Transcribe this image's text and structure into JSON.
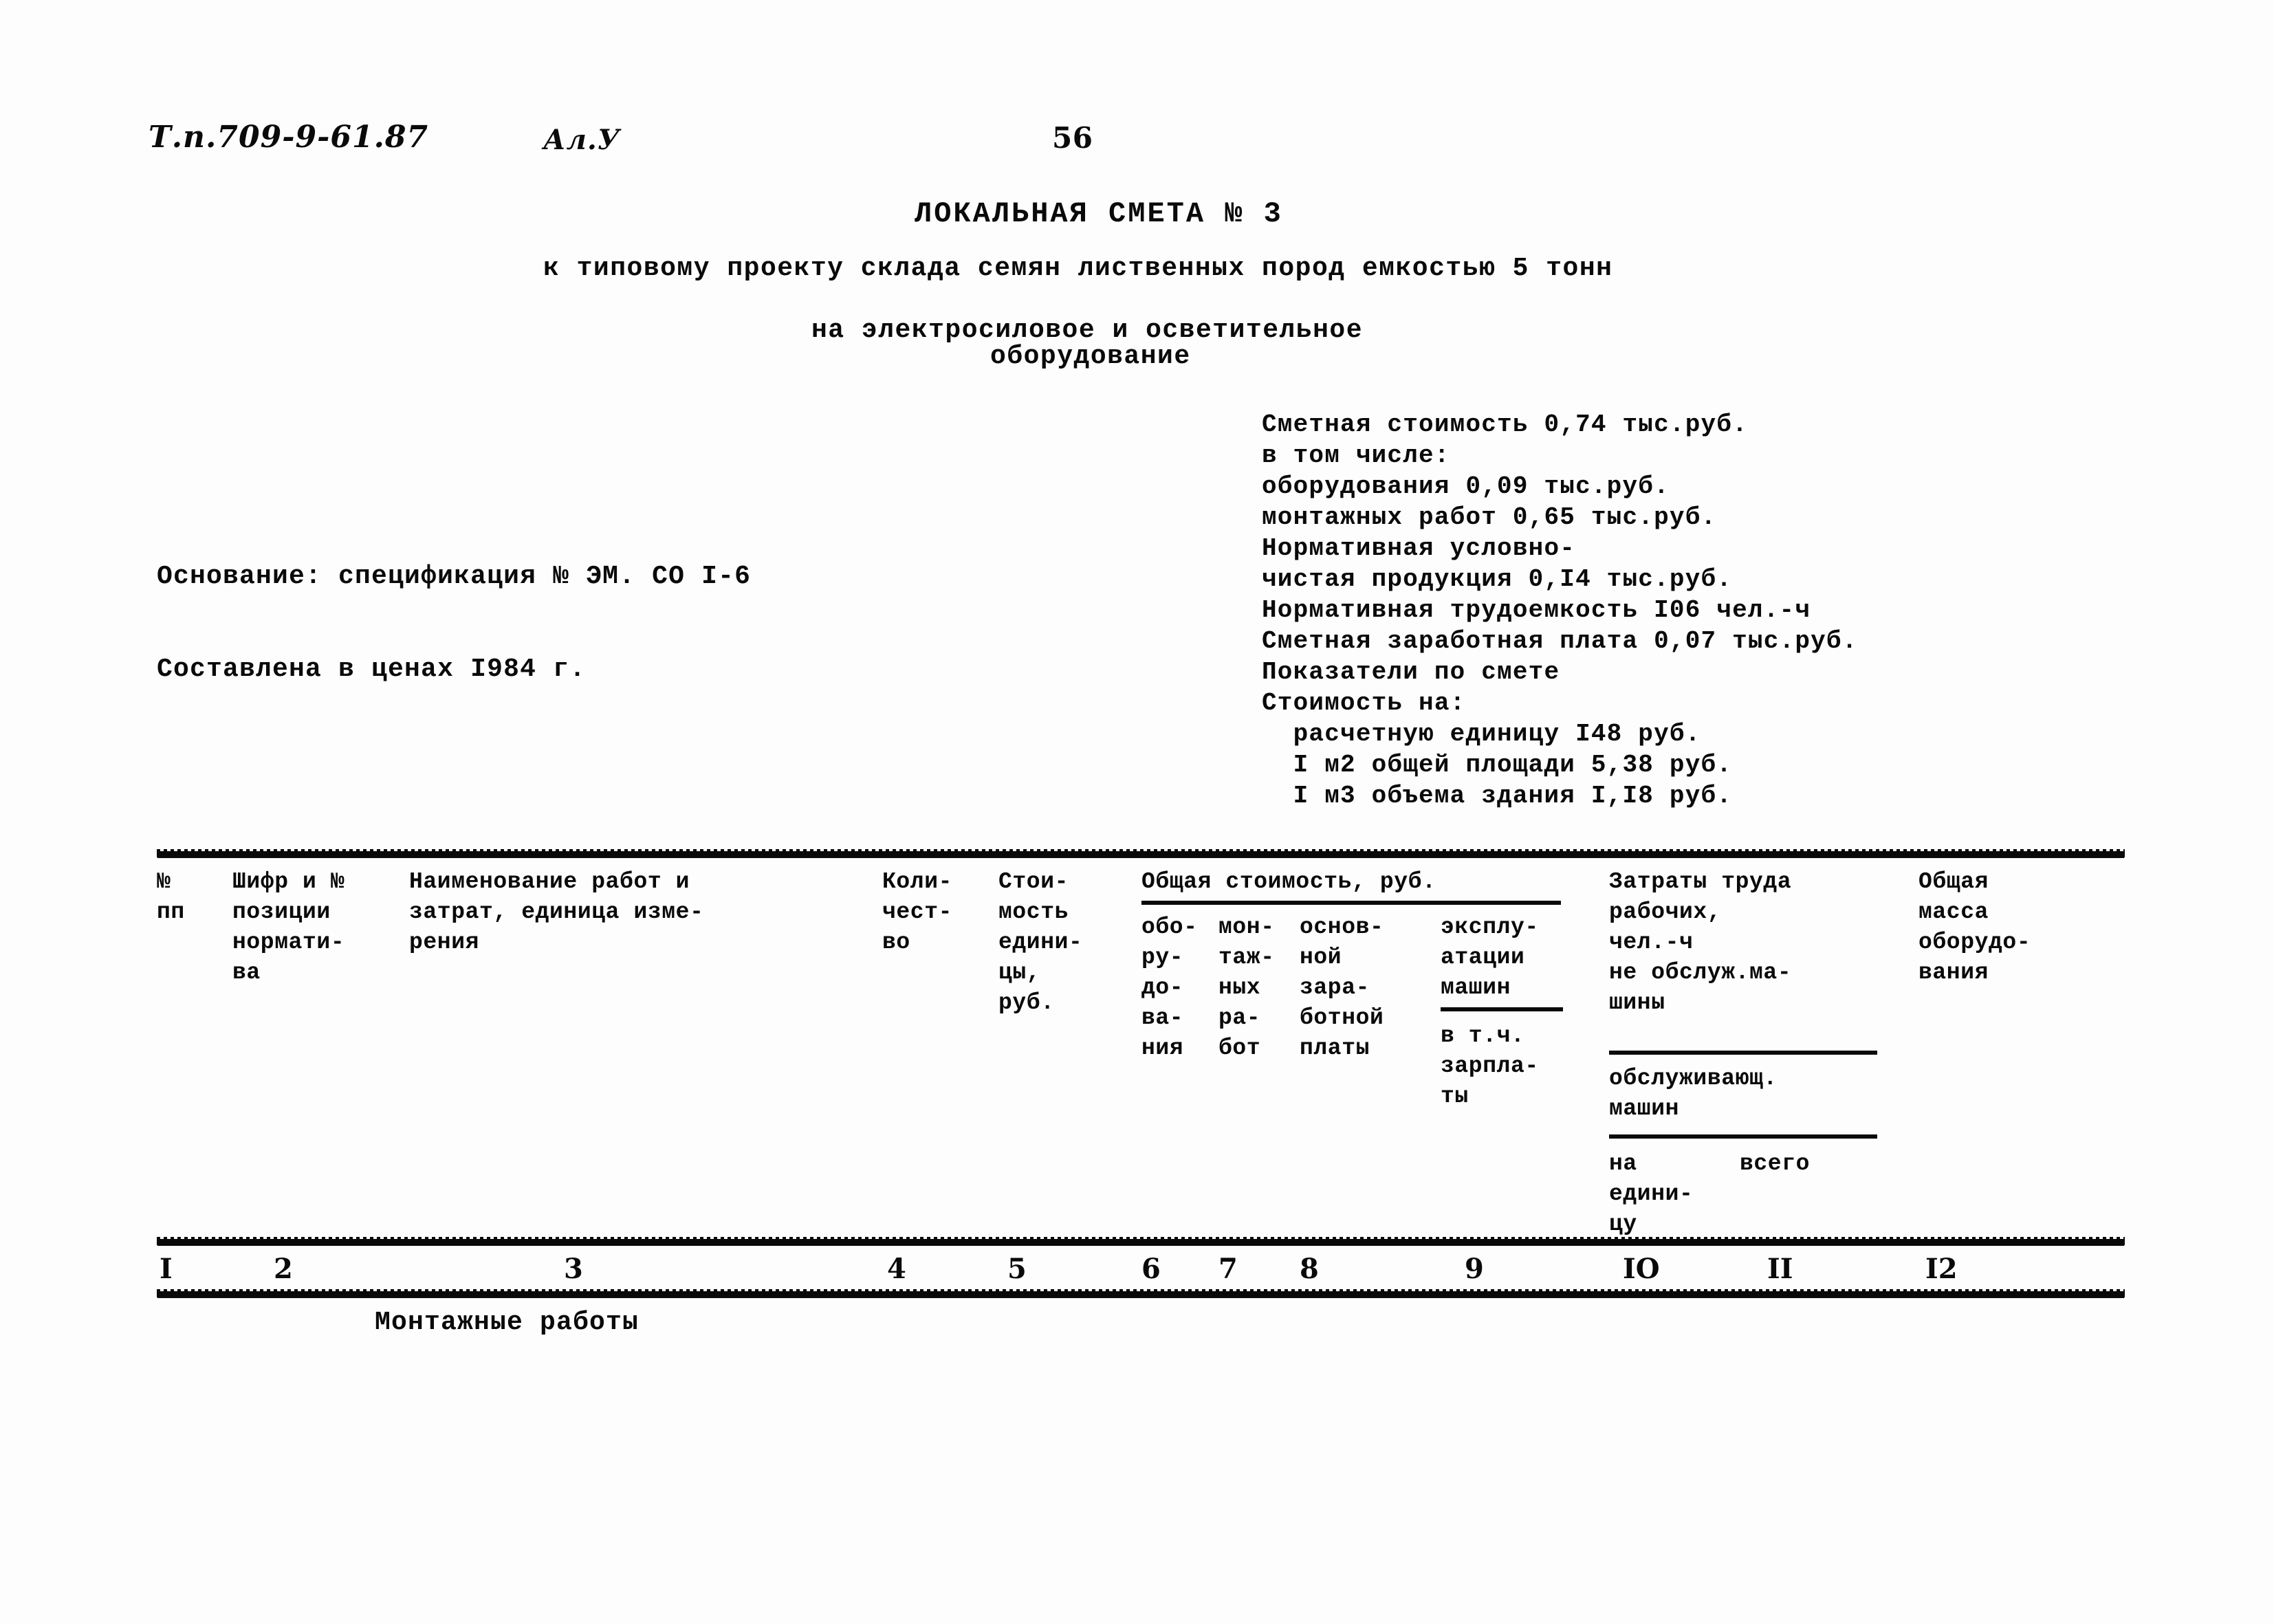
{
  "document": {
    "project_code": "Т.п.709-9-61.87",
    "album": "Ал.У",
    "page_number": "56",
    "title": "ЛОКАЛЬНАЯ СМЕТА № 3",
    "subtitle_line1": "к типовому проекту склада семян лиственных пород емкостью 5 тонн",
    "subtitle_line2": "на электросиловое и осветительное",
    "subtitle_line3": "оборудование",
    "basis": "Основание: спецификация № ЭМ. СО I-6",
    "prices": "Составлена в ценах I984 г."
  },
  "summary": {
    "lines": [
      "Сметная стоимость 0,74 тыс.руб.",
      "в том числе:",
      "оборудования 0,09 тыс.руб.",
      "монтажных работ 0,65 тыс.руб.",
      "Нормативная условно-",
      "чистая продукция 0,I4 тыс.руб.",
      "Нормативная трудоемкость I06 чел.-ч",
      "Сметная заработная плата 0,07 тыс.руб.",
      "Показатели по смете",
      "Стоимость на:",
      "  расчетную единицу I48 руб.",
      "  I м2 общей площади 5,38 руб.",
      "  I м3 объема здания I,I8 руб."
    ]
  },
  "table": {
    "headers": {
      "col1": [
        "№",
        "пп"
      ],
      "col2": [
        "Шифр и №",
        "позиции",
        "нормати-",
        "ва"
      ],
      "col3": [
        "Наименование работ и",
        "затрат, единица изме-",
        "рения"
      ],
      "col4": [
        "Коли-",
        "чест-",
        "во"
      ],
      "col5": [
        "Стои-",
        "мость",
        "едини-",
        "цы,",
        "руб."
      ],
      "group_total": "Общая стоимость, руб.",
      "col6": [
        "обо-",
        "ру-",
        "до-",
        "ва-",
        "ния"
      ],
      "col7": [
        "мон-",
        "таж-",
        "ных",
        "ра-",
        "бот"
      ],
      "col8": [
        "основ-",
        "ной",
        "зара-",
        "ботной",
        "платы"
      ],
      "col9": [
        "эксплу-",
        "атации",
        "машин",
        "в т.ч.",
        "зарпла-",
        "ты"
      ],
      "col10_11_title": [
        "Затраты труда",
        "рабочих,",
        "чел.-ч"
      ],
      "col10": [
        "не обслуж.ма-",
        "шины"
      ],
      "col11": [
        "обслуживающ.",
        "машин"
      ],
      "col10_sub": [
        "на",
        "едини-",
        "цу"
      ],
      "col11_sub": [
        "всего"
      ],
      "col12": [
        "Общая",
        "масса",
        "оборудо-",
        "вания"
      ]
    },
    "column_numbers": [
      "I",
      "2",
      "3",
      "4",
      "5",
      "6",
      "7",
      "8",
      "9",
      "IO",
      "II",
      "I2"
    ],
    "section_label": "Монтажные работы"
  }
}
